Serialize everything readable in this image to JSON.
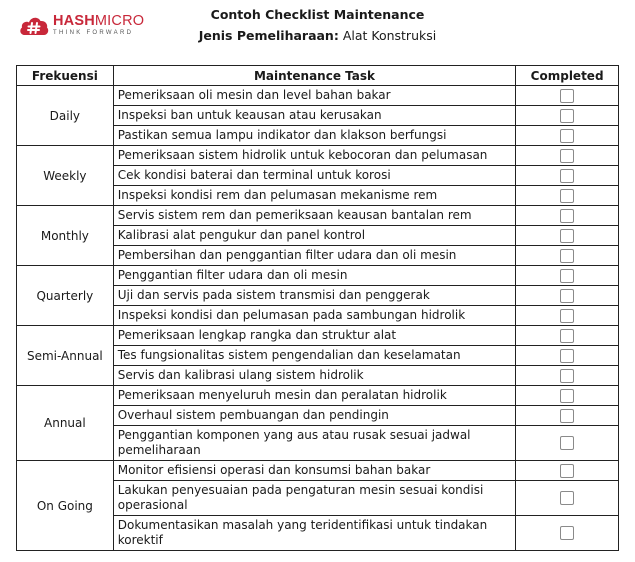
{
  "logo": {
    "name_bold": "HASH",
    "name_light": "MICRO",
    "tagline": "THINK FORWARD",
    "brand_color": "#c8283a"
  },
  "header": {
    "title": "Contoh Checklist Maintenance",
    "subtitle_label": "Jenis Pemeliharaan:",
    "subtitle_value": " Alat Konstruksi"
  },
  "table": {
    "columns": [
      "Frekuensi",
      "Maintenance Task",
      "Completed"
    ],
    "groups": [
      {
        "frequency": "Daily",
        "tasks": [
          {
            "task": "Pemeriksaan oli mesin dan level bahan bakar",
            "completed": false
          },
          {
            "task": "Inspeksi ban untuk keausan atau kerusakan",
            "completed": false
          },
          {
            "task": "Pastikan semua lampu indikator dan klakson berfungsi",
            "completed": false
          }
        ]
      },
      {
        "frequency": "Weekly",
        "tasks": [
          {
            "task": "Pemeriksaan sistem hidrolik untuk kebocoran dan pelumasan",
            "completed": false
          },
          {
            "task": "Cek kondisi baterai dan terminal untuk korosi",
            "completed": false
          },
          {
            "task": "Inspeksi kondisi rem dan pelumasan mekanisme rem",
            "completed": false
          }
        ]
      },
      {
        "frequency": "Monthly",
        "tasks": [
          {
            "task": "Servis sistem rem dan pemeriksaan keausan bantalan rem",
            "completed": false
          },
          {
            "task": "Kalibrasi alat pengukur dan panel kontrol",
            "completed": false
          },
          {
            "task": "Pembersihan dan penggantian filter udara dan oli mesin",
            "completed": false
          }
        ]
      },
      {
        "frequency": "Quarterly",
        "tasks": [
          {
            "task": "Penggantian filter udara dan oli mesin",
            "completed": false
          },
          {
            "task": "Uji dan servis pada sistem transmisi dan penggerak",
            "completed": false
          },
          {
            "task": "Inspeksi kondisi dan pelumasan pada sambungan hidrolik",
            "completed": false
          }
        ]
      },
      {
        "frequency": "Semi-Annual",
        "tasks": [
          {
            "task": "Pemeriksaan lengkap rangka dan struktur alat",
            "completed": false
          },
          {
            "task": "Tes fungsionalitas sistem pengendalian dan keselamatan",
            "completed": false
          },
          {
            "task": "Servis dan kalibrasi ulang sistem hidrolik",
            "completed": false
          }
        ]
      },
      {
        "frequency": "Annual",
        "tasks": [
          {
            "task": "Pemeriksaan menyeluruh mesin dan peralatan hidrolik",
            "completed": false
          },
          {
            "task": "Overhaul sistem pembuangan dan pendingin",
            "completed": false
          },
          {
            "task": "Penggantian komponen yang aus atau rusak sesuai jadwal pemeliharaan",
            "completed": false
          }
        ]
      },
      {
        "frequency": "On Going",
        "tasks": [
          {
            "task": "Monitor efisiensi operasi dan konsumsi bahan bakar",
            "completed": false
          },
          {
            "task": "Lakukan penyesuaian pada pengaturan mesin sesuai kondisi operasional",
            "completed": false
          },
          {
            "task": "Dokumentasikan masalah yang teridentifikasi untuk tindakan korektif",
            "completed": false
          }
        ]
      }
    ]
  }
}
